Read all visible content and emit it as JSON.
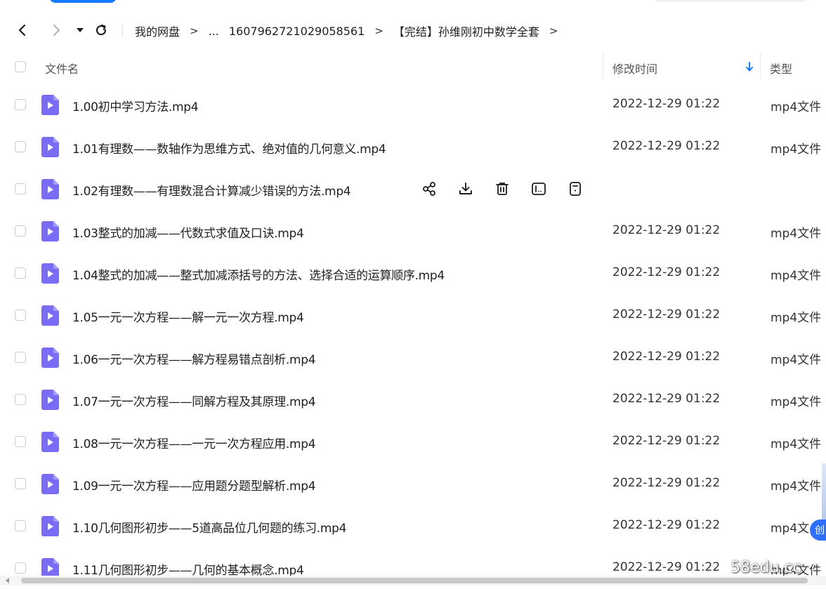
{
  "breadcrumb": {
    "items": [
      "我的网盘",
      "...",
      "1607962721029058561",
      "【完结】孙维刚初中数学全套"
    ],
    "separator": ">"
  },
  "header": {
    "name": "文件名",
    "time": "修改时间",
    "type": "类型"
  },
  "files": [
    {
      "name": "1.00初中学习方法.mp4",
      "time": "2022-12-29 01:22",
      "type": "mp4文件"
    },
    {
      "name": "1.01有理数——数轴作为思维方式、绝对值的几何意义.mp4",
      "time": "2022-12-29 01:22",
      "type": "mp4文件"
    },
    {
      "name": "1.02有理数——有理数混合计算减少错误的方法.mp4",
      "time": "",
      "type": ""
    },
    {
      "name": "1.03整式的加减——代数式求值及口诀.mp4",
      "time": "2022-12-29 01:22",
      "type": "mp4文件"
    },
    {
      "name": "1.04整式的加减——整式加减添括号的方法、选择合适的运算顺序.mp4",
      "time": "2022-12-29 01:22",
      "type": "mp4文件"
    },
    {
      "name": "1.05一元一次方程——解一元一次方程.mp4",
      "time": "2022-12-29 01:22",
      "type": "mp4文件"
    },
    {
      "name": "1.06一元一次方程——解方程易错点剖析.mp4",
      "time": "2022-12-29 01:22",
      "type": "mp4文件"
    },
    {
      "name": "1.07一元一次方程——同解方程及其原理.mp4",
      "time": "2022-12-29 01:22",
      "type": "mp4文件"
    },
    {
      "name": "1.08一元一次方程——一元一次方程应用.mp4",
      "time": "2022-12-29 01:22",
      "type": "mp4文件"
    },
    {
      "name": "1.09一元一次方程——应用题分题型解析.mp4",
      "time": "2022-12-29 01:22",
      "type": "mp4文件"
    },
    {
      "name": "1.10几何图形初步——5道高品位几何题的练习.mp4",
      "time": "2022-12-29 01:22",
      "type": "mp4文"
    },
    {
      "name": "1.11几何图形初步——几何的基本概念.mp4",
      "time": "2022-12-29 01:22",
      "type": "mp4文件"
    }
  ],
  "side_badge": "创",
  "watermark": "58edu.cc",
  "colors": {
    "accent": "#1677ff",
    "file_icon": "#7b6cf6",
    "sort_arrow": "#1677ff"
  }
}
